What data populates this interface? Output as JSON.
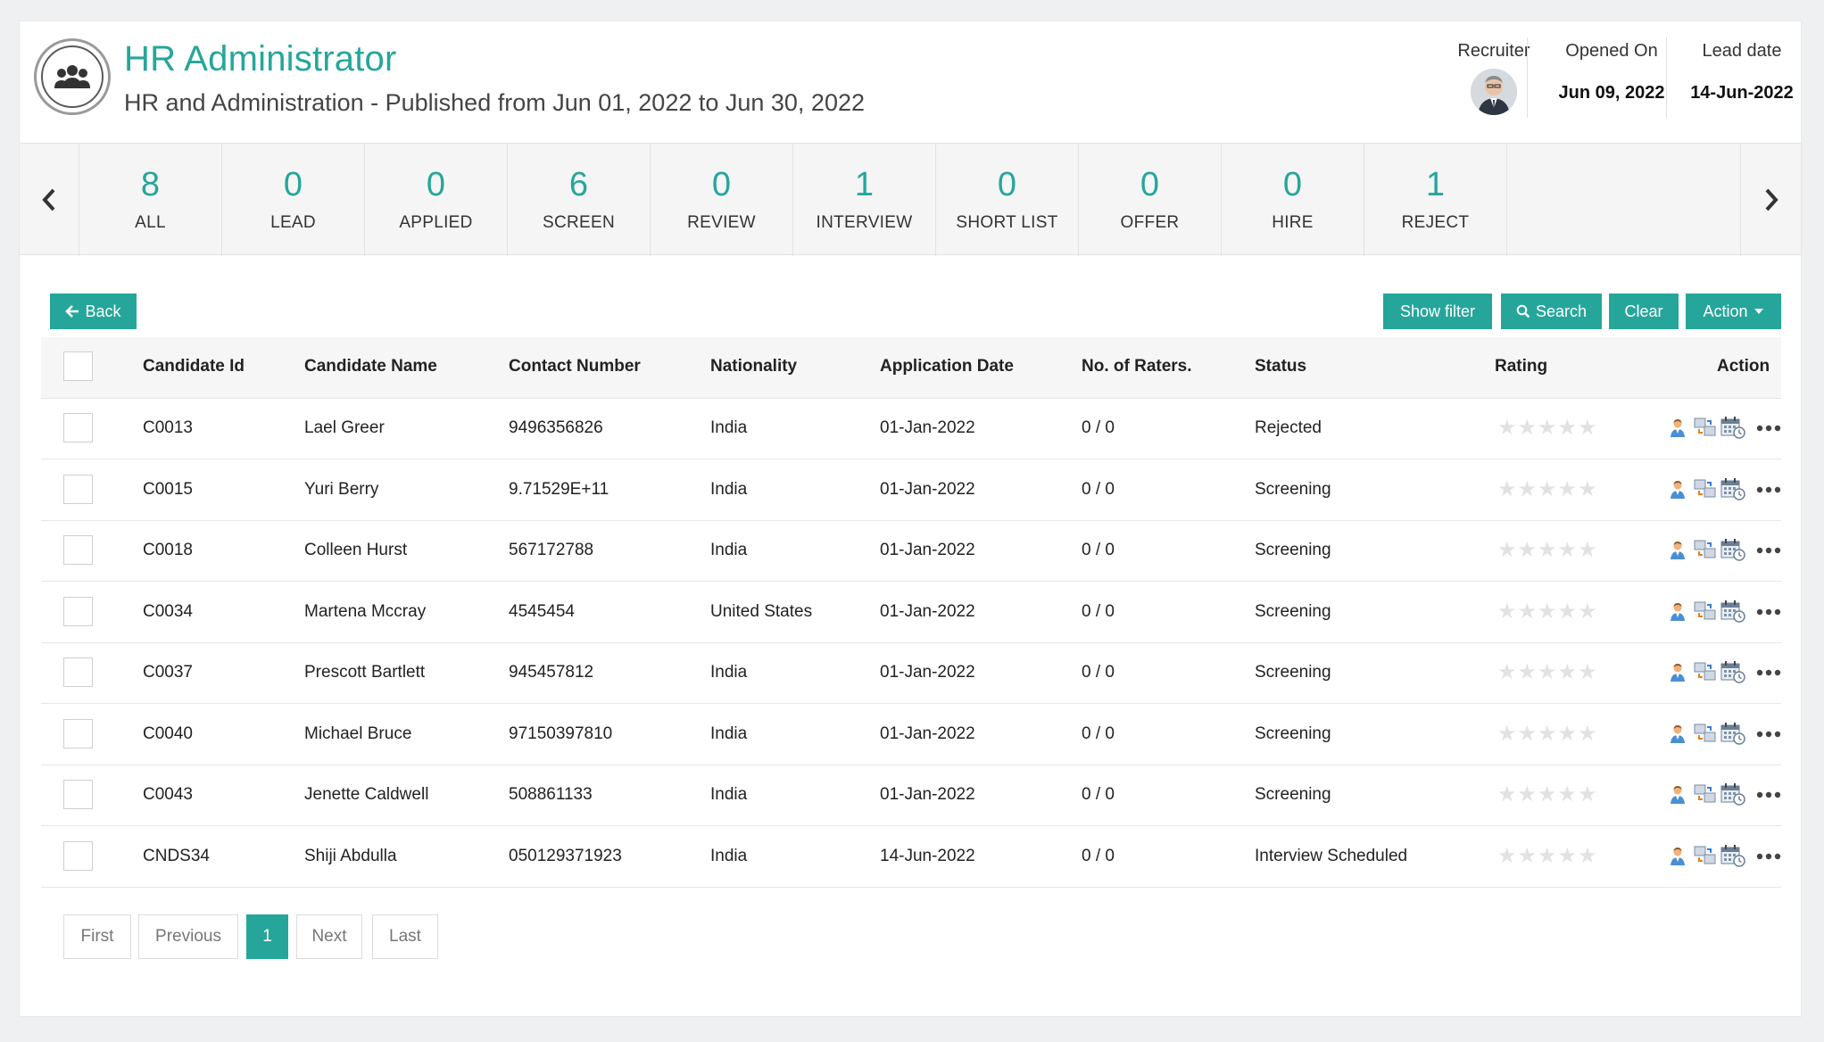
{
  "header": {
    "title": "HR Administrator",
    "subtitle": "HR and Administration - Published from Jun 01, 2022 to Jun 30, 2022",
    "recruiter_label": "Recruiter",
    "opened_label": "Opened On",
    "opened_value": "Jun 09, 2022",
    "lead_label": "Lead date",
    "lead_value": "14-Jun-2022"
  },
  "stages": [
    {
      "count": "8",
      "label": "ALL"
    },
    {
      "count": "0",
      "label": "LEAD"
    },
    {
      "count": "0",
      "label": "APPLIED"
    },
    {
      "count": "6",
      "label": "SCREEN"
    },
    {
      "count": "0",
      "label": "REVIEW"
    },
    {
      "count": "1",
      "label": "INTERVIEW"
    },
    {
      "count": "0",
      "label": "SHORT LIST"
    },
    {
      "count": "0",
      "label": "OFFER"
    },
    {
      "count": "0",
      "label": "HIRE"
    },
    {
      "count": "1",
      "label": "REJECT"
    }
  ],
  "toolbar": {
    "back": "Back",
    "show_filter": "Show filter",
    "search": "Search",
    "clear": "Clear",
    "action": "Action"
  },
  "table": {
    "headers": {
      "id": "Candidate Id",
      "name": "Candidate Name",
      "contact": "Contact Number",
      "nationality": "Nationality",
      "date": "Application Date",
      "raters": "No. of Raters.",
      "status": "Status",
      "rating": "Rating",
      "action": "Action"
    },
    "rows": [
      {
        "id": "C0013",
        "name": "Lael Greer",
        "contact": "9496356826",
        "nationality": "India",
        "date": "01-Jan-2022",
        "raters": "0 / 0",
        "status": "Rejected"
      },
      {
        "id": "C0015",
        "name": "Yuri Berry",
        "contact": "9.71529E+11",
        "nationality": "India",
        "date": "01-Jan-2022",
        "raters": "0 / 0",
        "status": "Screening"
      },
      {
        "id": "C0018",
        "name": "Colleen Hurst",
        "contact": "567172788",
        "nationality": "India",
        "date": "01-Jan-2022",
        "raters": "0 / 0",
        "status": "Screening"
      },
      {
        "id": "C0034",
        "name": "Martena Mccray",
        "contact": "4545454",
        "nationality": "United States",
        "date": "01-Jan-2022",
        "raters": "0 / 0",
        "status": "Screening"
      },
      {
        "id": "C0037",
        "name": "Prescott Bartlett",
        "contact": "945457812",
        "nationality": "India",
        "date": "01-Jan-2022",
        "raters": "0 / 0",
        "status": "Screening"
      },
      {
        "id": "C0040",
        "name": "Michael Bruce",
        "contact": "97150397810",
        "nationality": "India",
        "date": "01-Jan-2022",
        "raters": "0 / 0",
        "status": "Screening"
      },
      {
        "id": "C0043",
        "name": "Jenette Caldwell",
        "contact": "508861133",
        "nationality": "India",
        "date": "01-Jan-2022",
        "raters": "0 / 0",
        "status": "Screening"
      },
      {
        "id": "CNDS34",
        "name": "Shiji Abdulla",
        "contact": "050129371923",
        "nationality": "India",
        "date": "14-Jun-2022",
        "raters": "0 / 0",
        "status": "Interview Scheduled"
      }
    ]
  },
  "pagination": {
    "first": "First",
    "previous": "Previous",
    "current": "1",
    "next": "Next",
    "last": "Last"
  },
  "colors": {
    "accent": "#26a69a"
  }
}
